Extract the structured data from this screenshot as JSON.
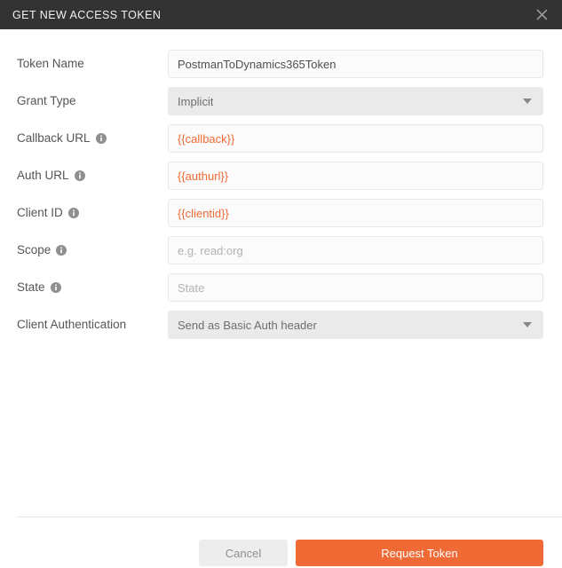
{
  "dialog": {
    "title": "GET NEW ACCESS TOKEN",
    "close_icon": "close-icon"
  },
  "form": {
    "fields": [
      {
        "label": "Token Name",
        "type": "text",
        "value": "PostmanToDynamics365Token",
        "placeholder": "",
        "has_info": false,
        "variable": false
      },
      {
        "label": "Grant Type",
        "type": "select",
        "value": "Implicit",
        "placeholder": "",
        "has_info": false,
        "variable": false
      },
      {
        "label": "Callback URL",
        "type": "text",
        "value": "{{callback}}",
        "placeholder": "",
        "has_info": true,
        "variable": true
      },
      {
        "label": "Auth URL",
        "type": "text",
        "value": "{{authurl}}",
        "placeholder": "",
        "has_info": true,
        "variable": true
      },
      {
        "label": "Client ID",
        "type": "text",
        "value": "{{clientid}}",
        "placeholder": "",
        "has_info": true,
        "variable": true
      },
      {
        "label": "Scope",
        "type": "text",
        "value": "",
        "placeholder": "e.g. read:org",
        "has_info": true,
        "variable": false
      },
      {
        "label": "State",
        "type": "text",
        "value": "",
        "placeholder": "State",
        "has_info": true,
        "variable": false
      },
      {
        "label": "Client Authentication",
        "type": "select",
        "value": "Send as Basic Auth header",
        "placeholder": "",
        "has_info": false,
        "variable": false
      }
    ]
  },
  "footer": {
    "cancel_label": "Cancel",
    "request_label": "Request Token"
  },
  "colors": {
    "header_bg": "#333333",
    "accent": "#f06a35",
    "variable_text": "#f06a35",
    "select_bg": "#eaeaea",
    "input_bg": "#fbfbfb",
    "cancel_bg": "#ededed"
  }
}
